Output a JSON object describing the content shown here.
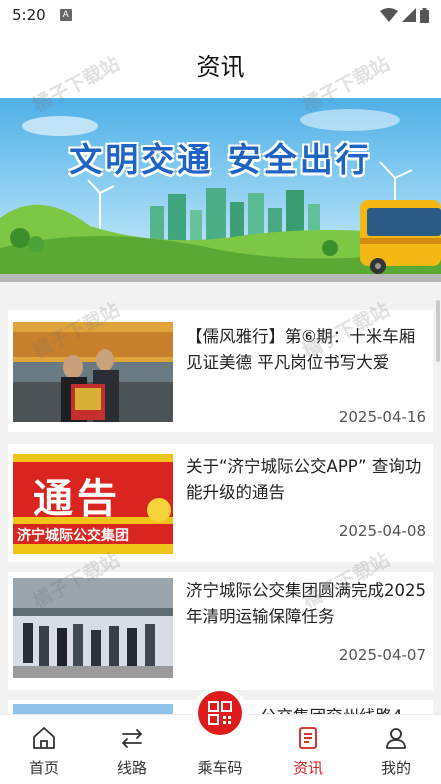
{
  "status_bar": {
    "time": "5:20",
    "notification_badge": "A",
    "icons": [
      "wifi-icon",
      "signal-icon",
      "battery-icon"
    ]
  },
  "header": {
    "title": "资讯"
  },
  "banner": {
    "slogan": "文明交通 安全出行"
  },
  "news": [
    {
      "title": "【儒风雅行】第⑥期：十米车厢见证美德 平凡岗位书写大爱",
      "date": "2025-04-16",
      "thumb_caption": ""
    },
    {
      "title": "关于“济宁城际公交APP” 查询功能升级的通告",
      "date": "2025-04-08",
      "thumb_caption": "通告",
      "thumb_subcaption": "济宁城际公交集团"
    },
    {
      "title": "济宁城际公交集团圆满完成2025年清明运输保障任务",
      "date": "2025-04-07"
    },
    {
      "title": "公交集团兖州线路4",
      "date": ""
    }
  ],
  "tabs": [
    {
      "label": "首页",
      "icon": "home-icon"
    },
    {
      "label": "线路",
      "icon": "route-icon"
    },
    {
      "label": "乘车码",
      "icon": "qr-code-icon"
    },
    {
      "label": "资讯",
      "icon": "news-icon",
      "active": true
    },
    {
      "label": "我的",
      "icon": "profile-icon"
    }
  ],
  "watermark": "橘子下载站",
  "colors": {
    "accent": "#d21f1f",
    "banner_text": "#1f63c4"
  }
}
